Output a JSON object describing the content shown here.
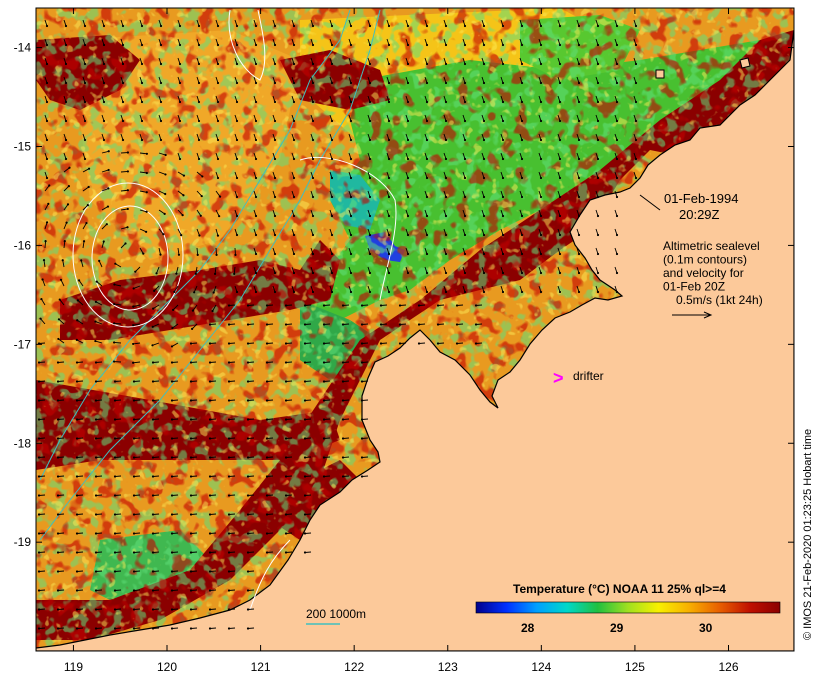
{
  "map": {
    "x_axis": {
      "min": 118.6,
      "max": 126.7,
      "ticks": [
        "119",
        "120",
        "121",
        "122",
        "123",
        "124",
        "125",
        "126"
      ]
    },
    "y_axis": {
      "min": -20.1,
      "max": -13.6,
      "ticks": [
        "-14",
        "-15",
        "-16",
        "-17",
        "-18",
        "-19"
      ]
    },
    "colors": {
      "land": "#fcc99a",
      "warm": "#8b0000",
      "orange": "#e89a20",
      "green": "#48c030",
      "coast": "#000000",
      "contour": "#ffffff",
      "isobath": "#3fbfbf",
      "drifter": "#ff00ff"
    }
  },
  "annotations": {
    "date": "01-Feb-1994",
    "time": "20:29Z",
    "info_lines": [
      "Altimetric sealevel",
      "(0.1m contours)",
      "and velocity for",
      "01-Feb 20Z",
      "0.5m/s (1kt 24h)"
    ],
    "drifter_symbol": ">",
    "drifter_label": "drifter",
    "isobath_label": "200  1000m"
  },
  "colorbar": {
    "title": "Temperature (°C) NOAA 11 25% ql>=4",
    "ticks": [
      "28",
      "29",
      "30"
    ]
  },
  "credit": "© IMOS 21-Feb-2020 01:23:25 Hobart time"
}
